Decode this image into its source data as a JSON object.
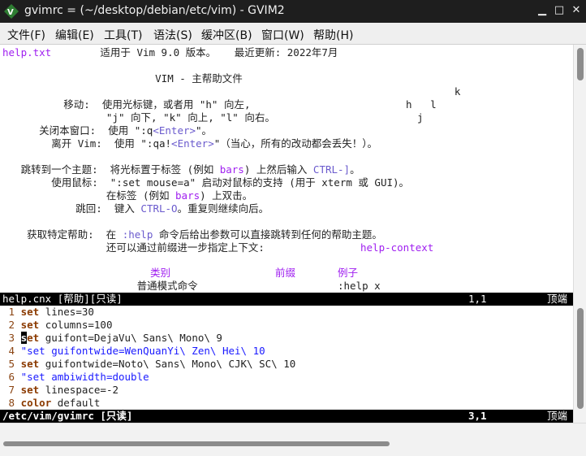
{
  "window": {
    "title": "gvimrc = (~/desktop/debian/etc/vim) - GVIM2",
    "minimize": "▁",
    "maximize": "□",
    "close": "✕"
  },
  "menu": [
    "文件(F)",
    "编辑(E)",
    "工具(T)",
    "语法(S)",
    "缓冲区(B)",
    "窗口(W)",
    "帮助(H)"
  ],
  "help": {
    "l1_file": "help.txt",
    "l1_rest": "        适用于 Vim 9.0 版本。   最近更新: 2022年7月",
    "l2": "                         VIM - 主帮助文件",
    "l3": "                                                                          k",
    "l4a": "          移动:  使用光标键，或者用 \"h\" 向左,",
    "l4b": "h   l",
    "l5a": "                 \"j\" 向下, \"k\" 向上, \"l\" 向右。",
    "l5b": "j",
    "l6a": "      关闭本窗口:  使用 \":q",
    "l6tag": "<Enter>",
    "l6b": "\"。",
    "l7a": "        离开 Vim:  使用 \":qa!",
    "l7tag": "<Enter>",
    "l7b": "\"（当心，所有的改动都会丢失！）。",
    "l8a": "   跳转到一个主题:  将光标置于标签 (例如 ",
    "l8tag": "bars",
    "l8b": ") 上然后输入 ",
    "l8key": "CTRL-]",
    "l8c": "。",
    "l9": "        使用鼠标:  \":set mouse=a\" 启动对鼠标的支持 (用于 xterm 或 GUI)。",
    "l10a": "                 在标签 (例如 ",
    "l10tag": "bars",
    "l10b": ") 上双击。",
    "l11a": "            跳回:  键入 ",
    "l11key": "CTRL-O",
    "l11b": "。重复则继续向后。",
    "l12a": "    获取特定帮助:  在 ",
    "l12cmd": ":help",
    "l12b": " 命令后给出参数可以直接跳转到任何的帮助主题。",
    "l13a": "                 还可以通过前缀进一步指定上下文:",
    "l13tag": "help-context",
    "l14_c1": "类别",
    "l14_c2": "前缀",
    "l14_c3": "例子",
    "l15a": "                      普通模式命令",
    "l15b": ":help x"
  },
  "status_top": {
    "name": "help.cnx [帮助][只读]",
    "pos": "1,1",
    "where": "顶端"
  },
  "code": [
    {
      "n": "1",
      "kw": "set",
      "rest": " lines=30",
      "comment": false
    },
    {
      "n": "2",
      "kw": "set",
      "rest": " columns=100",
      "comment": false
    },
    {
      "n": "3",
      "kw": "set",
      "rest": " guifont=DejaVu\\ Sans\\ Mono\\ 9",
      "comment": false
    },
    {
      "n": "4",
      "kw": "",
      "rest": "\"set guifontwide=WenQuanYi\\ Zen\\ Hei\\ 10",
      "comment": true
    },
    {
      "n": "5",
      "kw": "set",
      "rest": " guifontwide=Noto\\ Sans\\ Mono\\ CJK\\ SC\\ 10",
      "comment": false
    },
    {
      "n": "6",
      "kw": "",
      "rest": "\"set ambiwidth=double",
      "comment": true
    },
    {
      "n": "7",
      "kw": "set",
      "rest": " linespace=-2",
      "comment": false
    },
    {
      "n": "8",
      "kw": "color",
      "rest": " default",
      "comment": false
    }
  ],
  "status_bottom": {
    "name": "/etc/vim/gvimrc [只读]",
    "pos": "3,1",
    "where": "顶端"
  },
  "colors": {
    "keyword": "#8b3a00",
    "comment": "#1a1aff",
    "tag": "#6a5acd",
    "special": "#a020f0"
  }
}
